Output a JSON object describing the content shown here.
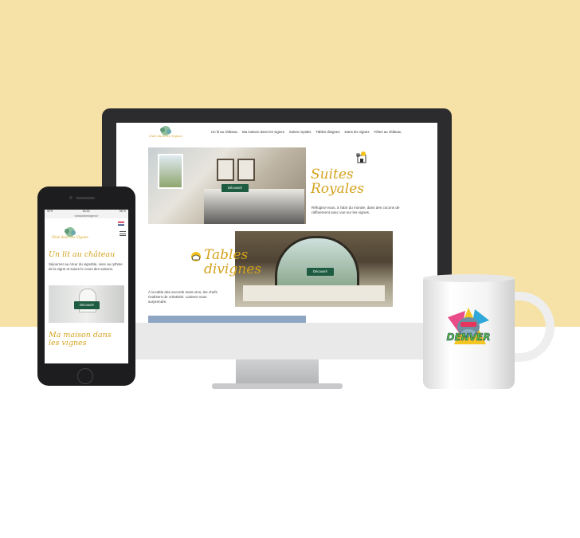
{
  "desktop": {
    "nav": {
      "logo_alt": "Nuit dans les Vignes",
      "items": [
        "Un lit au château",
        "Ma maison dans les vignes",
        "Suites royales",
        "Tables divignes",
        "Dans les vignes",
        "Fêtes au château"
      ]
    },
    "section1": {
      "title": "Suites Royales",
      "text": "Réfugiez-vous, à l'abri du monde, dans des cocons de raffinement avec vue sur les vignes.",
      "button": "Découvrir"
    },
    "section2": {
      "title": "Tables divignes",
      "text": "À la table des accords mets-vins, les chefs rivalisent de créativité. Laissez-vous surprendre.",
      "button": "Découvrir"
    }
  },
  "phone": {
    "status": {
      "carrier": "SFR",
      "time": "16:32",
      "battery": "98 %"
    },
    "url": "nuitsdanslesvignes.fr",
    "section1": {
      "title": "Un lit au château",
      "text": "Séjourner au cœur du vignoble, vivre au rythme de la vigne et suivre le cours des saisons.",
      "button": "Découvrir"
    },
    "section2": {
      "title": "Ma maison dans les vignes"
    }
  },
  "mug": {
    "label": "DENVER"
  },
  "colors": {
    "background_top": "#f6e2a6",
    "accent_gold": "#d4a21c",
    "button_green": "#1e5c42"
  }
}
